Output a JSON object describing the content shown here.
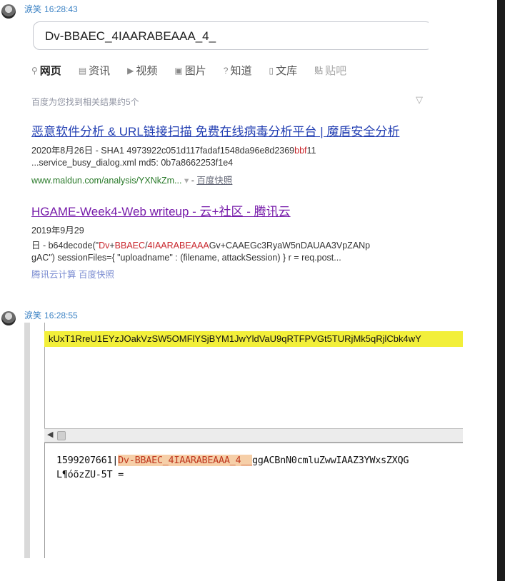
{
  "message1": {
    "sender": "涙笑",
    "time": "16:28:43"
  },
  "screenshot1": {
    "search_query": "Dv-BBAEC_4IAARABEAAA_4_",
    "tabs": [
      {
        "label": "网页",
        "icon": "search-icon",
        "active": true
      },
      {
        "label": "资讯",
        "icon": "news-icon"
      },
      {
        "label": "视频",
        "icon": "video-icon"
      },
      {
        "label": "图片",
        "icon": "image-icon"
      },
      {
        "label": "知道",
        "icon": "question-icon"
      },
      {
        "label": "文库",
        "icon": "doc-icon"
      },
      {
        "label": "贴吧",
        "icon": "tieba-icon"
      }
    ],
    "result_count": "百度为您找到相关结果约5个",
    "results": [
      {
        "title": "恶意软件分析 & URL链接扫描 免费在线病毒分析平台 | 魔盾安全分析",
        "line1_prefix": "2020年8月26日 - SHA1 4973922c051d117fadaf1548da96e8d2369",
        "line1_hl": "bbf",
        "line1_suffix": "11",
        "line2": "...service_busy_dialog.xml md5: 0b7a8662253f1e4",
        "url": "www.maldun.com/analysis/YXNkZm...",
        "url_arrow": "▾",
        "cache": "百度快照"
      },
      {
        "title": "HGAME-Week4-Web writeup - 云+社区 - 腾讯云",
        "date": "2019年9月29",
        "line1_prefix": "日 - b64decode(\"",
        "line1_hl1": "Dv",
        "line1_plus": "+",
        "line1_hl2": "BBAEC",
        "line1_slash": "/",
        "line1_hl3": "4IAARABEAAA",
        "line1_rest": "Gv+CAAEGc3RyaW5nDAUAA3VpZANp",
        "line2": "gAC\") sessionFiles={ \"uploadname\" : (filename, attackSession) } r = req.post...",
        "footer": "腾讯云计算  百度快照"
      }
    ]
  },
  "message2": {
    "sender": "涙笑",
    "time": "16:28:55"
  },
  "screenshot2": {
    "yellow_text": "kUxT1RreU1EYzJOakVzSW5OMFlYSjBYM1JwYldVaU9qRTFPVGt5TURjMk5qRjlCbk4wY",
    "line1_prefix": "1599207661|",
    "line1_hl": "Dv-BBAEC_4IAARABEAAA_4__",
    "line1_rest": "ggACBnN0cmluZwwIAAZ3YWxsZXQG",
    "line2": "L¶óõzZU-5T =",
    "scroll_arrow": "◀"
  }
}
